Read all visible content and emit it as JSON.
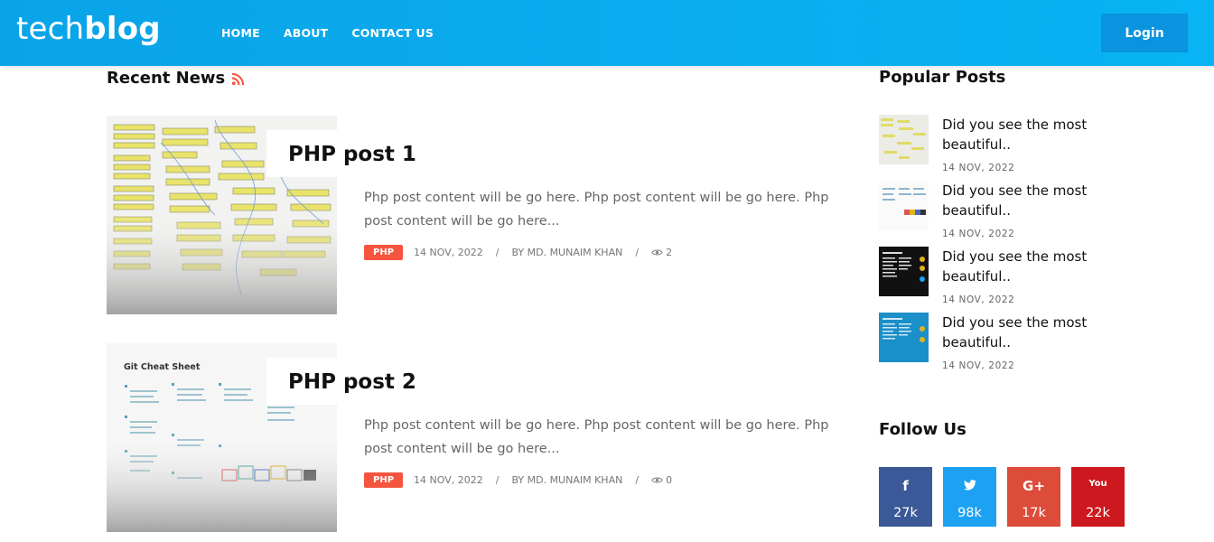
{
  "header": {
    "logo_light": "tech",
    "logo_bold": "blog",
    "nav": [
      "HOME",
      "ABOUT",
      "CONTACT US"
    ],
    "login_label": "Login"
  },
  "recent": {
    "title": "Recent News",
    "icon": "rss-icon",
    "posts": [
      {
        "title": "PHP post 1",
        "excerpt": "Php post content will be go here. Php post content will be go here. Php post content will be go here...",
        "tag": "PHP",
        "date": "14 NOV, 2022",
        "author": "BY MD. MUNAIM KHAN",
        "views": "2",
        "thumb_caption": ""
      },
      {
        "title": "PHP post 2",
        "excerpt": "Php post content will be go here. Php post content will be go here. Php post content will be go here...",
        "tag": "PHP",
        "date": "14 NOV, 2022",
        "author": "BY MD. MUNAIM KHAN",
        "views": "0",
        "thumb_caption": "Git Cheat Sheet"
      }
    ]
  },
  "popular": {
    "title": "Popular Posts",
    "items": [
      {
        "title": "Did you see the most beautiful..",
        "date": "14 NOV, 2022"
      },
      {
        "title": "Did you see the most beautiful..",
        "date": "14 NOV, 2022"
      },
      {
        "title": "Did you see the most beautiful..",
        "date": "14 NOV, 2022"
      },
      {
        "title": "Did you see the most beautiful..",
        "date": "14 NOV, 2022"
      }
    ]
  },
  "follow": {
    "title": "Follow Us",
    "networks": [
      {
        "name": "facebook",
        "glyph": "f",
        "count": "27k",
        "color": "#3b5998"
      },
      {
        "name": "twitter",
        "glyph": "🐦",
        "count": "98k",
        "color": "#1da1f2"
      },
      {
        "name": "google-plus",
        "glyph": "G+",
        "count": "17k",
        "color": "#dd4b39"
      },
      {
        "name": "youtube",
        "glyph": "You",
        "count": "22k",
        "color": "#cc181e"
      }
    ]
  },
  "colors": {
    "header": "#0aa3e8",
    "tag": "#f5543e",
    "rss": "#f5543e"
  }
}
